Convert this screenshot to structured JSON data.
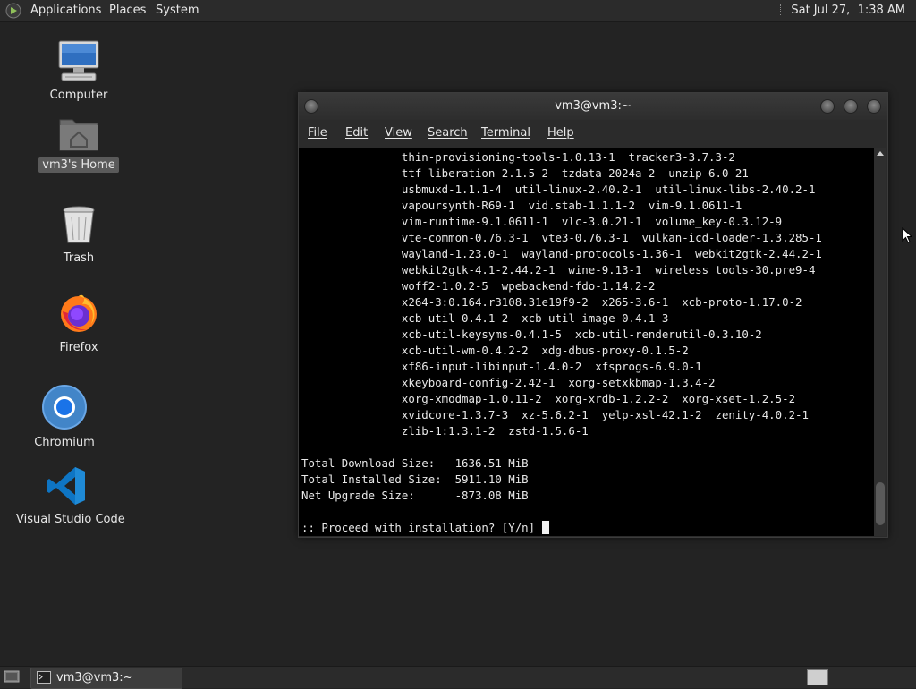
{
  "top_panel": {
    "menus": [
      "Applications",
      "Places",
      "System"
    ],
    "clock": "Sat Jul 27,  1:38 AM"
  },
  "desktop": {
    "icons": [
      {
        "label": "Computer",
        "icon": "computer-icon"
      },
      {
        "label": "vm3's Home",
        "icon": "home-folder-icon",
        "selected": true
      },
      {
        "label": "Trash",
        "icon": "trash-icon"
      },
      {
        "label": "Firefox",
        "icon": "firefox-icon"
      },
      {
        "label": "Chromium",
        "icon": "chromium-icon"
      },
      {
        "label": "Visual Studio Code",
        "icon": "vscode-icon"
      }
    ]
  },
  "terminal_window": {
    "title": "vm3@vm3:~",
    "menu": [
      "File",
      "Edit",
      "View",
      "Search",
      "Terminal",
      "Help"
    ],
    "lines": [
      "               thin-provisioning-tools-1.0.13-1  tracker3-3.7.3-2",
      "               ttf-liberation-2.1.5-2  tzdata-2024a-2  unzip-6.0-21",
      "               usbmuxd-1.1.1-4  util-linux-2.40.2-1  util-linux-libs-2.40.2-1",
      "               vapoursynth-R69-1  vid.stab-1.1.1-2  vim-9.1.0611-1",
      "               vim-runtime-9.1.0611-1  vlc-3.0.21-1  volume_key-0.3.12-9",
      "               vte-common-0.76.3-1  vte3-0.76.3-1  vulkan-icd-loader-1.3.285-1",
      "               wayland-1.23.0-1  wayland-protocols-1.36-1  webkit2gtk-2.44.2-1",
      "               webkit2gtk-4.1-2.44.2-1  wine-9.13-1  wireless_tools-30.pre9-4",
      "               woff2-1.0.2-5  wpebackend-fdo-1.14.2-2",
      "               x264-3:0.164.r3108.31e19f9-2  x265-3.6-1  xcb-proto-1.17.0-2",
      "               xcb-util-0.4.1-2  xcb-util-image-0.4.1-3",
      "               xcb-util-keysyms-0.4.1-5  xcb-util-renderutil-0.3.10-2",
      "               xcb-util-wm-0.4.2-2  xdg-dbus-proxy-0.1.5-2",
      "               xf86-input-libinput-1.4.0-2  xfsprogs-6.9.0-1",
      "               xkeyboard-config-2.42-1  xorg-setxkbmap-1.3.4-2",
      "               xorg-xmodmap-1.0.11-2  xorg-xrdb-1.2.2-2  xorg-xset-1.2.5-2",
      "               xvidcore-1.3.7-3  xz-5.6.2-1  yelp-xsl-42.1-2  zenity-4.0.2-1",
      "               zlib-1:1.3.1-2  zstd-1.5.6-1",
      "",
      "Total Download Size:   1636.51 MiB",
      "Total Installed Size:  5911.10 MiB",
      "Net Upgrade Size:      -873.08 MiB",
      "",
      ":: Proceed with installation? [Y/n] "
    ]
  },
  "bottom_panel": {
    "taskbar_item": "vm3@vm3:~"
  }
}
